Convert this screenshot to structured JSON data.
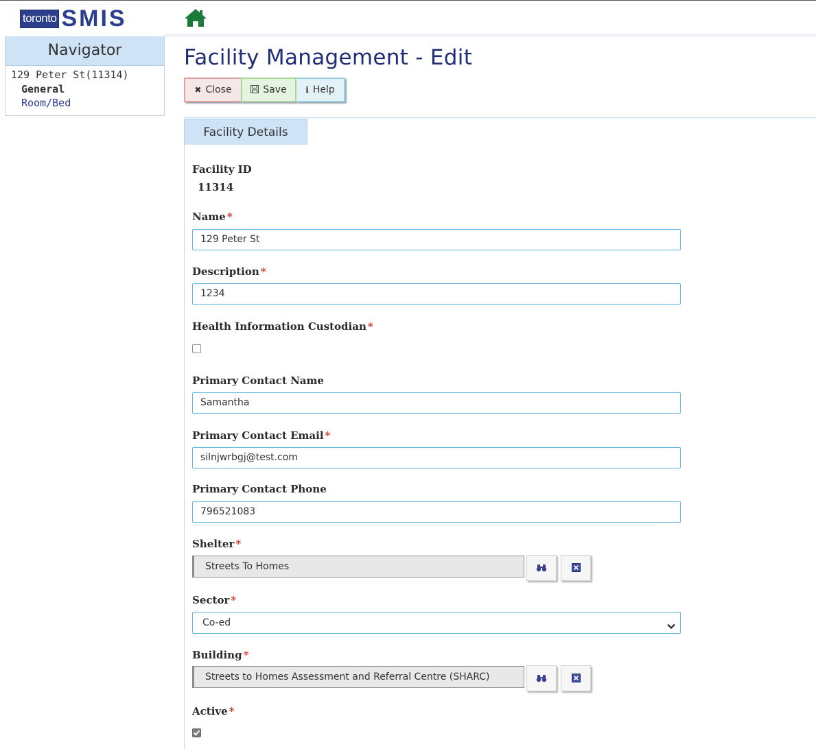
{
  "header": {
    "logo_toronto": "toronto",
    "logo_smis": "SMIS",
    "home_icon": "home-icon"
  },
  "navigator": {
    "title": "Navigator",
    "facility": "129 Peter St(11314)",
    "items": [
      {
        "label": "General",
        "active": true
      },
      {
        "label": "Room/Bed",
        "active": false
      }
    ]
  },
  "page": {
    "title": "Facility Management - Edit"
  },
  "toolbar": {
    "close_label": "Close",
    "save_label": "Save",
    "help_label": "Help",
    "close_icon": "close-icon",
    "save_icon": "floppy-disk-icon",
    "help_icon": "info-icon"
  },
  "tabs": [
    {
      "label": "Facility Details",
      "active": true
    }
  ],
  "form": {
    "facility_id": {
      "label": "Facility ID",
      "value": "11314"
    },
    "name": {
      "label": "Name",
      "required": true,
      "value": "129 Peter St"
    },
    "description": {
      "label": "Description",
      "required": true,
      "value": "1234"
    },
    "health_custodian": {
      "label": "Health Information Custodian",
      "required": true,
      "checked": false
    },
    "contact_name": {
      "label": "Primary Contact Name",
      "value": "Samantha"
    },
    "contact_email": {
      "label": "Primary Contact Email",
      "required": true,
      "value": "silnjwrbgj@test.com"
    },
    "contact_phone": {
      "label": "Primary Contact Phone",
      "value": "796521083"
    },
    "shelter": {
      "label": "Shelter",
      "required": true,
      "value": "Streets To Homes"
    },
    "sector": {
      "label": "Sector",
      "required": true,
      "value": "Co-ed"
    },
    "building": {
      "label": "Building",
      "required": true,
      "value": "Streets to Homes Assessment and Referral Centre (SHARC)"
    },
    "active": {
      "label": "Active",
      "required": true,
      "checked": true
    }
  },
  "required_marker": "*",
  "colors": {
    "brand_blue": "#2b3f8c",
    "title_blue": "#222d77",
    "input_border": "#62b6e6",
    "required_red": "#d9342b",
    "tab_bg": "#cfe3f6",
    "home_green": "#1a7a3a"
  }
}
